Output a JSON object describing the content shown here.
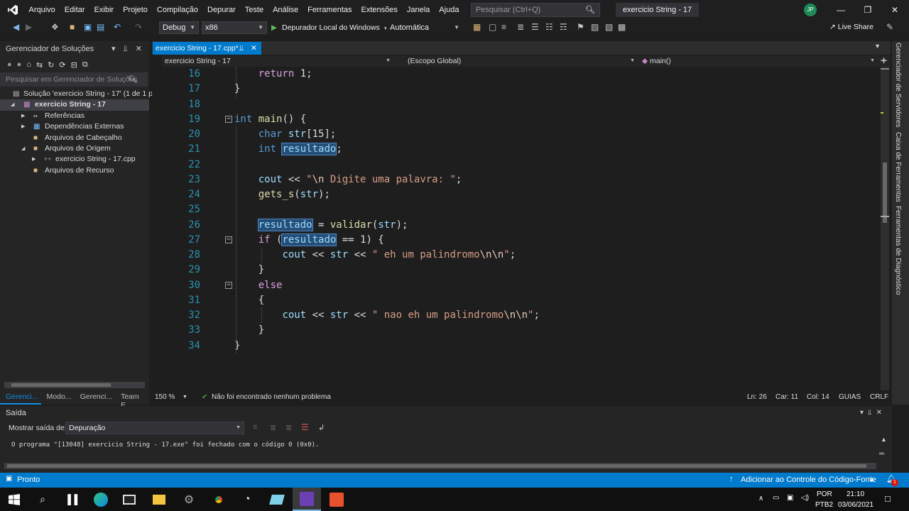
{
  "menubar": {
    "items": [
      "Arquivo",
      "Editar",
      "Exibir",
      "Projeto",
      "Compilação",
      "Depurar",
      "Teste",
      "Análise",
      "Ferramentas",
      "Extensões",
      "Janela",
      "Ajuda"
    ],
    "search_placeholder": "Pesquisar (Ctrl+Q)",
    "window_title": "exercicio String - 17",
    "avatar": "JP"
  },
  "toolbar": {
    "config": "Debug",
    "platform": "x86",
    "debugger": "Depurador Local do Windows",
    "mode": "Automática",
    "live_share": "Live Share"
  },
  "solution_explorer": {
    "title": "Gerenciador de Soluções",
    "search_placeholder": "Pesquisar em Gerenciador de Soluções",
    "items": [
      {
        "label": "Solução 'exercicio String - 17' (1 de 1 pr"
      },
      {
        "label": "exercicio String - 17"
      },
      {
        "label": "Referências"
      },
      {
        "label": "Dependências Externas"
      },
      {
        "label": "Arquivos de Cabeçalho"
      },
      {
        "label": "Arquivos de Origem"
      },
      {
        "label": "exercicio String - 17.cpp"
      },
      {
        "label": "Arquivos de Recurso"
      }
    ],
    "bottom_tabs": [
      "Gerenci...",
      "Modo...",
      "Gerenci...",
      "Team E..."
    ]
  },
  "editor": {
    "tab_label": "exercicio String - 17.cpp*",
    "nav_project": "exercicio String - 17",
    "nav_scope": "(Escopo Global)",
    "nav_member": "main()",
    "zoom": "150 %",
    "issues": "Não foi encontrado nenhum problema",
    "ln": "Ln: 26",
    "car": "Car: 11",
    "col": "Col: 14",
    "guias": "GUIAS",
    "crlf": "CRLF"
  },
  "code_lines": [
    {
      "n": "16",
      "seg": [
        [
          "",
          "    "
        ],
        [
          "ctl",
          "return"
        ],
        [
          "",
          " 1;"
        ]
      ]
    },
    {
      "n": "17",
      "seg": [
        [
          "",
          "}"
        ]
      ]
    },
    {
      "n": "18",
      "seg": []
    },
    {
      "n": "19",
      "seg": [
        [
          "kw",
          "int"
        ],
        [
          "",
          " "
        ],
        [
          "fn",
          "main"
        ],
        [
          "",
          "() {"
        ]
      ]
    },
    {
      "n": "20",
      "seg": [
        [
          "",
          "    "
        ],
        [
          "kw",
          "char"
        ],
        [
          "",
          " "
        ],
        [
          "var",
          "str"
        ],
        [
          "",
          "[15];"
        ]
      ]
    },
    {
      "n": "21",
      "seg": [
        [
          "",
          "    "
        ],
        [
          "kw",
          "int"
        ],
        [
          "",
          " "
        ],
        [
          "var hl",
          "resultado"
        ],
        [
          "",
          ";"
        ]
      ]
    },
    {
      "n": "22",
      "seg": []
    },
    {
      "n": "23",
      "seg": [
        [
          "",
          "    "
        ],
        [
          "var",
          "cout"
        ],
        [
          "",
          " << "
        ],
        [
          "str",
          "\""
        ],
        [
          "esc",
          "\\n"
        ],
        [
          "str",
          " Digite uma palavra: \""
        ],
        [
          "",
          ";"
        ]
      ]
    },
    {
      "n": "24",
      "seg": [
        [
          "",
          "    "
        ],
        [
          "fn",
          "gets_s"
        ],
        [
          "",
          "("
        ],
        [
          "var",
          "str"
        ],
        [
          "",
          ");"
        ]
      ]
    },
    {
      "n": "25",
      "seg": []
    },
    {
      "n": "26",
      "seg": [
        [
          "",
          "    "
        ],
        [
          "var hl",
          "resultado"
        ],
        [
          "",
          " = "
        ],
        [
          "fn",
          "validar"
        ],
        [
          "",
          "("
        ],
        [
          "var",
          "str"
        ],
        [
          "",
          ");"
        ]
      ]
    },
    {
      "n": "27",
      "seg": [
        [
          "",
          "    "
        ],
        [
          "ctl",
          "if"
        ],
        [
          "",
          " ("
        ],
        [
          "var hl",
          "resultado"
        ],
        [
          "",
          " == 1) {"
        ]
      ]
    },
    {
      "n": "28",
      "seg": [
        [
          "",
          "        "
        ],
        [
          "var",
          "cout"
        ],
        [
          "",
          " << "
        ],
        [
          "var",
          "str"
        ],
        [
          "",
          " << "
        ],
        [
          "str",
          "\" eh um palindromo"
        ],
        [
          "esc",
          "\\n\\n"
        ],
        [
          "str",
          "\""
        ],
        [
          "",
          ";"
        ]
      ]
    },
    {
      "n": "29",
      "seg": [
        [
          "",
          "    }"
        ]
      ]
    },
    {
      "n": "30",
      "seg": [
        [
          "",
          "    "
        ],
        [
          "ctl",
          "else"
        ]
      ]
    },
    {
      "n": "31",
      "seg": [
        [
          "",
          "    {"
        ]
      ]
    },
    {
      "n": "32",
      "seg": [
        [
          "",
          "        "
        ],
        [
          "var",
          "cout"
        ],
        [
          "",
          " << "
        ],
        [
          "var",
          "str"
        ],
        [
          "",
          " << "
        ],
        [
          "str",
          "\" nao eh um palindromo"
        ],
        [
          "esc",
          "\\n\\n"
        ],
        [
          "str",
          "\""
        ],
        [
          "",
          ";"
        ]
      ]
    },
    {
      "n": "33",
      "seg": [
        [
          "",
          "    }"
        ]
      ]
    },
    {
      "n": "34",
      "seg": [
        [
          "",
          "}"
        ]
      ]
    }
  ],
  "right_strip": [
    "Gerenciador de Servidores",
    "Caixa de Ferramentas",
    "Ferramentas de Diagnóstico"
  ],
  "output": {
    "title": "Saída",
    "show_label": "Mostrar saída de:",
    "source": "Depuração",
    "text": "O programa \"[13048] exercicio String - 17.exe\" foi fechado com o código 0 (0x0)."
  },
  "statusbar": {
    "ready": "Pronto",
    "source_control": "Adicionar ao Controle do Código-Fonte",
    "notifications": "1"
  },
  "taskbar": {
    "lang": "POR",
    "layout": "PTB2",
    "time": "21:10",
    "date": "03/06/2021"
  }
}
